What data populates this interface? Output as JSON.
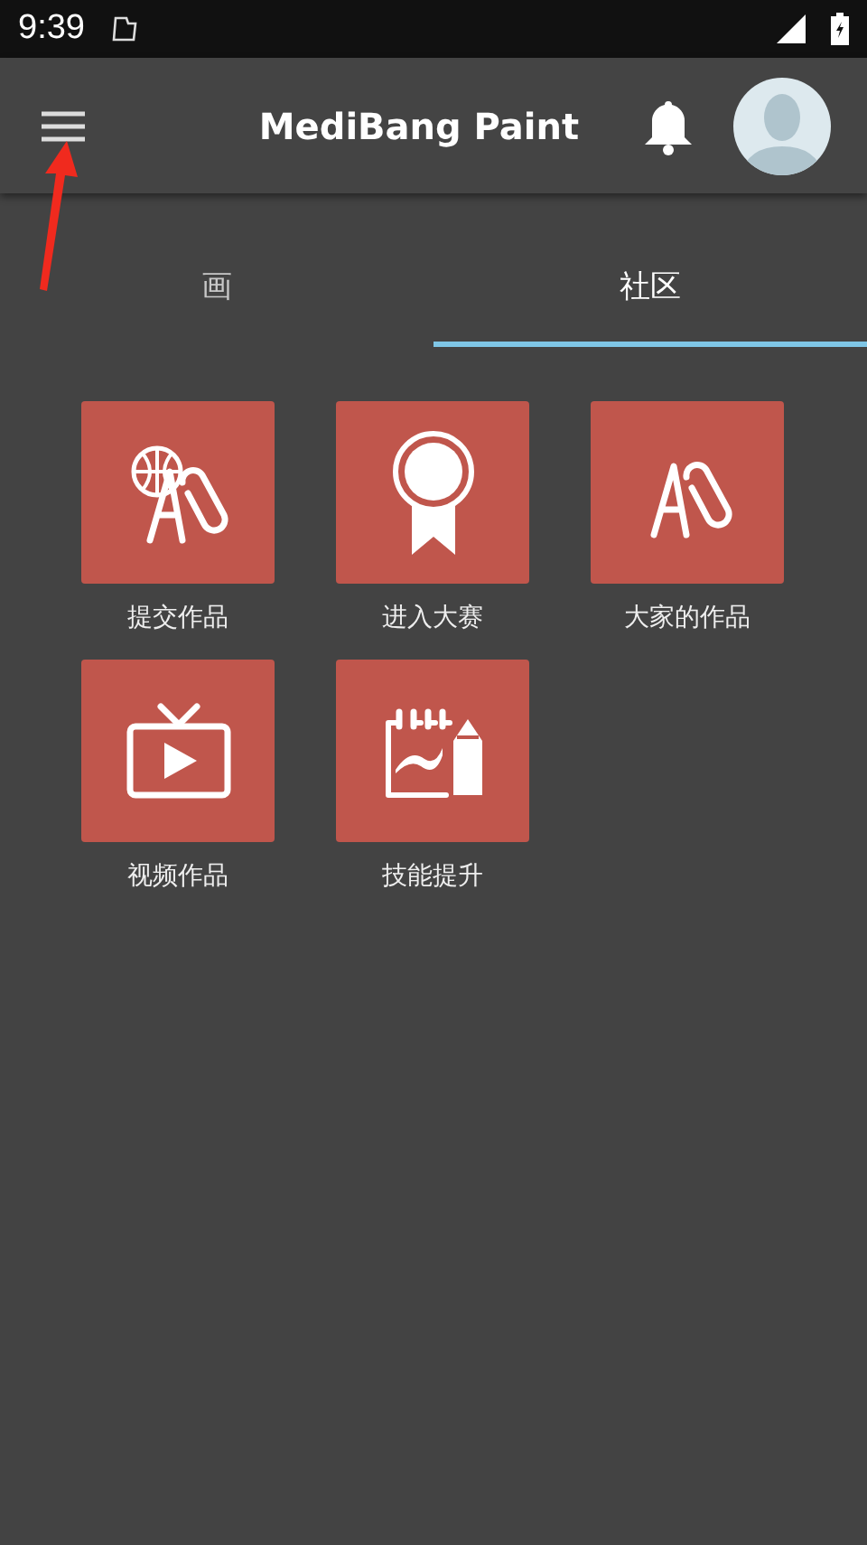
{
  "status_bar": {
    "time": "9:39"
  },
  "app_bar": {
    "title": "MediBang Paint"
  },
  "tabs": [
    {
      "label": "画",
      "selected": false
    },
    {
      "label": "社区",
      "selected": true
    }
  ],
  "tiles": [
    {
      "label": "提交作品"
    },
    {
      "label": "进入大赛"
    },
    {
      "label": "大家的作品"
    },
    {
      "label": "视频作品"
    },
    {
      "label": "技能提升"
    }
  ]
}
